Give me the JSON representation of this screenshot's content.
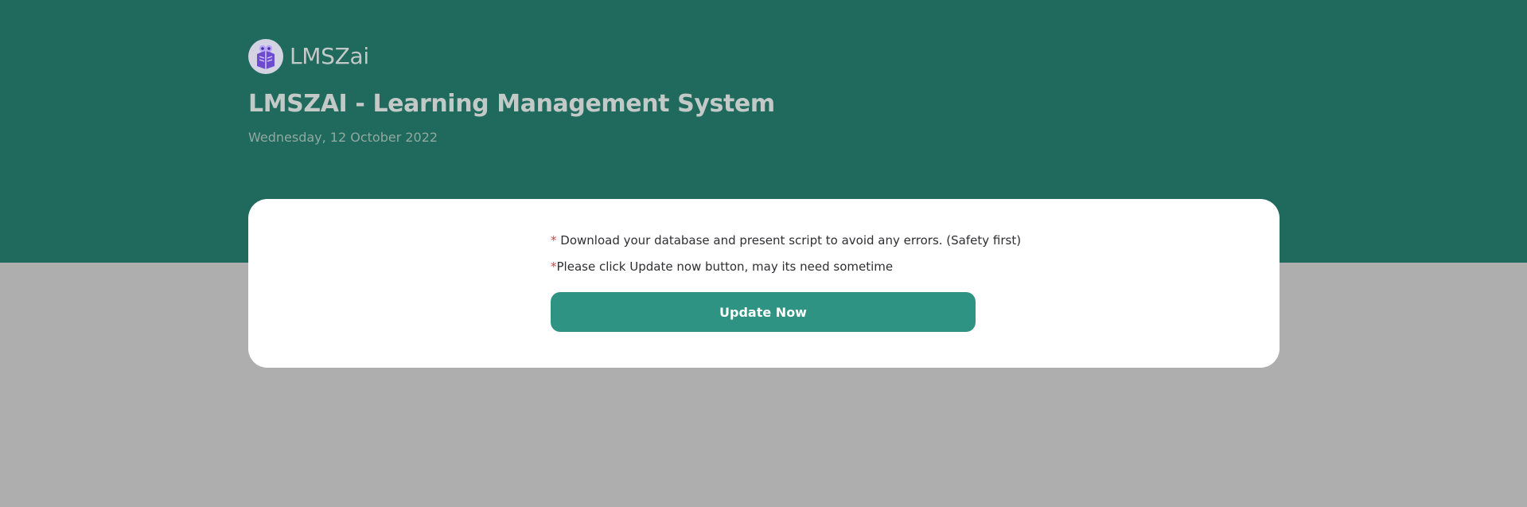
{
  "brand": {
    "name": "LMSZai",
    "logo_icon": "book-owl-icon"
  },
  "header": {
    "title": "LMSZAI - Learning Management System",
    "date": "Wednesday, 12 October 2022"
  },
  "notice": {
    "items": [
      {
        "marker": "*",
        "text": "Download your database and present script to avoid any errors. (Safety first)"
      },
      {
        "marker": "*",
        "text": "Please click Update now button, may its need sometime"
      }
    ]
  },
  "actions": {
    "update_label": "Update Now"
  },
  "colors": {
    "hero_background": "#1f695d",
    "page_background": "#aeaeaf",
    "card_background": "#ffffff",
    "button_background": "#2e9382",
    "asterisk": "#d1424b"
  }
}
